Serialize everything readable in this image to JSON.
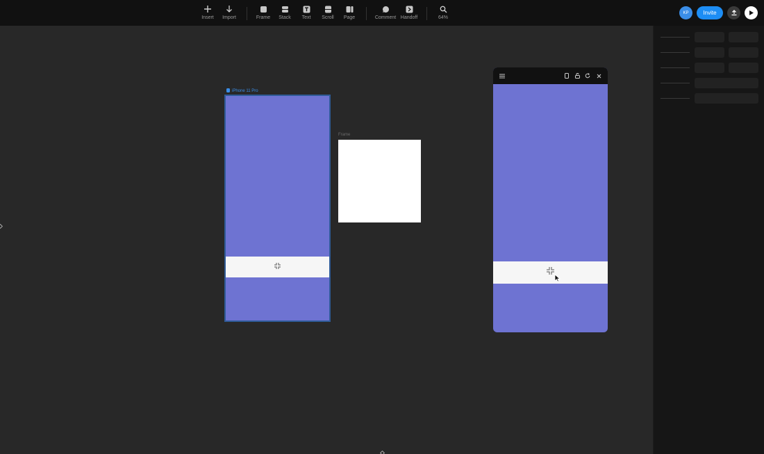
{
  "toolbar": {
    "tools": [
      {
        "id": "insert",
        "label": "Insert",
        "icon": "plus-icon"
      },
      {
        "id": "import",
        "label": "Import",
        "icon": "arrow-down-icon"
      },
      {
        "id": "frame",
        "label": "Frame",
        "icon": "frame-icon"
      },
      {
        "id": "stack",
        "label": "Stack",
        "icon": "stack-icon"
      },
      {
        "id": "text",
        "label": "Text",
        "icon": "text-icon"
      },
      {
        "id": "scroll",
        "label": "Scroll",
        "icon": "scroll-icon"
      },
      {
        "id": "page",
        "label": "Page",
        "icon": "page-icon"
      },
      {
        "id": "comment",
        "label": "Comment",
        "icon": "comment-icon"
      },
      {
        "id": "handoff",
        "label": "Handoff",
        "icon": "handoff-icon"
      },
      {
        "id": "zoom",
        "label": "64%",
        "icon": "search-icon"
      }
    ],
    "avatar_initials": "KP",
    "invite_label": "Invite"
  },
  "canvas": {
    "phone_frame_label": "iPhone 11 Pro",
    "plain_frame_label": "Frame"
  },
  "colors": {
    "canvas_bg": "#282828",
    "frame_purple": "#6e73d2",
    "selection_blue": "#3b8ee8",
    "accent": "#1d8df4"
  }
}
